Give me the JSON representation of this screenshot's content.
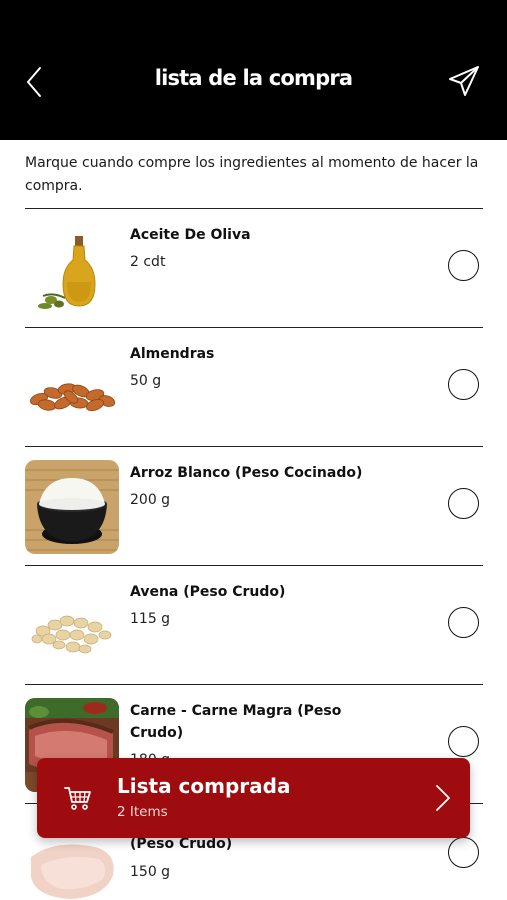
{
  "header": {
    "title": "lista de la compra",
    "back_icon": "chevron-left-icon",
    "send_icon": "paper-plane-icon"
  },
  "intro_text": "Marque cuando compre los ingredientes al momento de hacer la compra.",
  "items": [
    {
      "name": "Aceite De Oliva",
      "quantity": "2 cdt",
      "checked": false
    },
    {
      "name": "Almendras",
      "quantity": "50 g",
      "checked": false
    },
    {
      "name": "Arroz Blanco (Peso Cocinado)",
      "quantity": "200 g",
      "checked": false
    },
    {
      "name": "Avena (Peso Crudo)",
      "quantity": "115 g",
      "checked": false
    },
    {
      "name": "Carne - Carne Magra (Peso Crudo)",
      "quantity": "180 g",
      "checked": false
    },
    {
      "name": "(Peso Crudo)",
      "quantity": "150 g",
      "checked": false
    }
  ],
  "bought_bar": {
    "title": "Lista comprada",
    "count": "2 Items",
    "icon": "shopping-cart-icon",
    "color": "#9e0c0f"
  }
}
